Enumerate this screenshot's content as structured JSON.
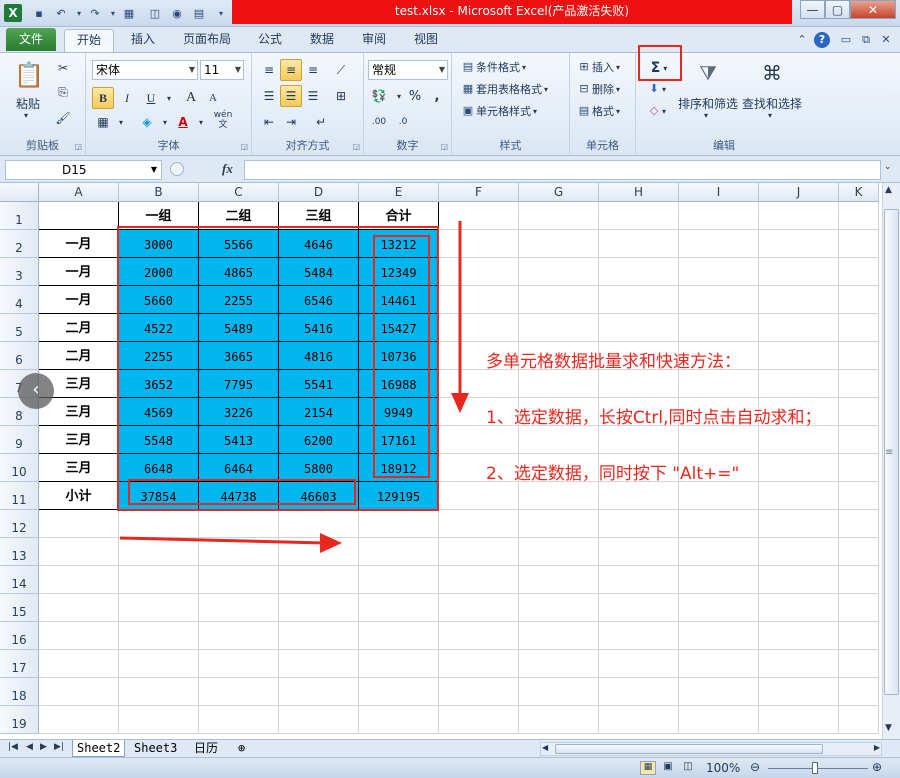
{
  "window": {
    "title": "test.xlsx  -  Microsoft Excel(产品激活失败)",
    "app_icon": "X"
  },
  "tabs": {
    "file": "文件",
    "items": [
      "开始",
      "插入",
      "页面布局",
      "公式",
      "数据",
      "审阅",
      "视图"
    ],
    "active": "开始"
  },
  "ribbon": {
    "clipboard": {
      "label": "剪贴板",
      "paste": "粘贴"
    },
    "font": {
      "label": "字体",
      "name": "宋体",
      "size": "11",
      "bold": "B",
      "italic": "I",
      "underline": "U",
      "grow": "A",
      "shrink": "A",
      "wen": "wén"
    },
    "alignment": {
      "label": "对齐方式"
    },
    "number": {
      "label": "数字",
      "format": "常规",
      "percent": "%"
    },
    "styles": {
      "label": "样式",
      "conditional": "条件格式",
      "table": "套用表格格式",
      "cell": "单元格样式"
    },
    "cells": {
      "label": "单元格",
      "insert": "插入",
      "delete": "删除",
      "format": "格式"
    },
    "editing": {
      "label": "编辑",
      "sum": "Σ",
      "sort": "排序和筛选",
      "find": "查找和选择"
    }
  },
  "formula_bar": {
    "name_box": "D15",
    "fx": "fx"
  },
  "columns": [
    "A",
    "B",
    "C",
    "D",
    "E",
    "F",
    "G",
    "H",
    "I",
    "J",
    "K"
  ],
  "rows": [
    "1",
    "2",
    "3",
    "4",
    "5",
    "6",
    "7",
    "8",
    "9",
    "10",
    "11",
    "12",
    "13",
    "14",
    "15",
    "16",
    "17",
    "18",
    "19"
  ],
  "table": {
    "headers": [
      "",
      "一组",
      "二组",
      "三组",
      "合计"
    ],
    "data": [
      [
        "一月",
        "3000",
        "5566",
        "4646",
        "13212"
      ],
      [
        "一月",
        "2000",
        "4865",
        "5484",
        "12349"
      ],
      [
        "一月",
        "5660",
        "2255",
        "6546",
        "14461"
      ],
      [
        "二月",
        "4522",
        "5489",
        "5416",
        "15427"
      ],
      [
        "二月",
        "2255",
        "3665",
        "4816",
        "10736"
      ],
      [
        "三月",
        "3652",
        "7795",
        "5541",
        "16988"
      ],
      [
        "三月",
        "4569",
        "3226",
        "2154",
        "9949"
      ],
      [
        "三月",
        "5548",
        "5413",
        "6200",
        "17161"
      ],
      [
        "三月",
        "6648",
        "6464",
        "5800",
        "18912"
      ]
    ],
    "subtotal": [
      "小计",
      "37854",
      "44738",
      "46603",
      "129195"
    ]
  },
  "annotations": {
    "title": "多单元格数据批量求和快速方法：",
    "step1": "1、选定数据，长按Ctrl,同时点击自动求和；",
    "step2": "2、选定数据，同时按下 \"Alt+=\""
  },
  "sheets": [
    "Sheet2",
    "Sheet3",
    "日历"
  ],
  "active_sheet": "Sheet2",
  "status": {
    "zoom": "100%"
  },
  "colors": {
    "highlight": "#00b6ef",
    "annotation": "#e8271f",
    "title_bar": "#ee1111"
  }
}
